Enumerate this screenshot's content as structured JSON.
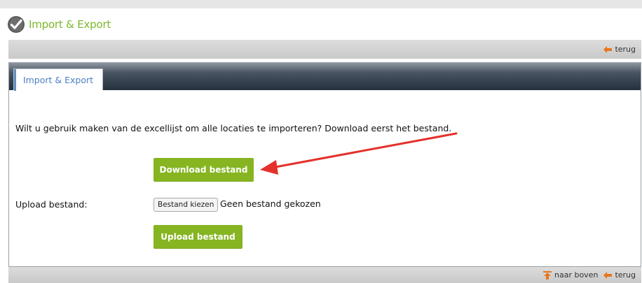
{
  "header": {
    "title": "Import & Export",
    "logo_icon": "checkmark-badge-icon"
  },
  "top_bar": {
    "back_label": "terug",
    "back_icon": "arrow-left-icon"
  },
  "tabs": [
    {
      "label": "Import & Export",
      "active": true
    }
  ],
  "content": {
    "intro_text": "Wilt u gebruik maken van de excellijst om alle locaties te importeren? Download eerst het bestand.",
    "download_button": "Download bestand",
    "upload_label": "Upload bestand:",
    "file_chooser_button": "Bestand kiezen",
    "file_chooser_status": "Geen bestand gekozen",
    "upload_button": "Upload bestand"
  },
  "bottom_bar": {
    "to_top_label": "naar boven",
    "to_top_icon": "arrow-up-icon",
    "back_label": "terug",
    "back_icon": "arrow-left-icon"
  },
  "colors": {
    "brand_green": "#7ab829",
    "button_green": "#86b521",
    "annotation_red": "#e5302b",
    "tab_text": "#4a7fc0"
  }
}
